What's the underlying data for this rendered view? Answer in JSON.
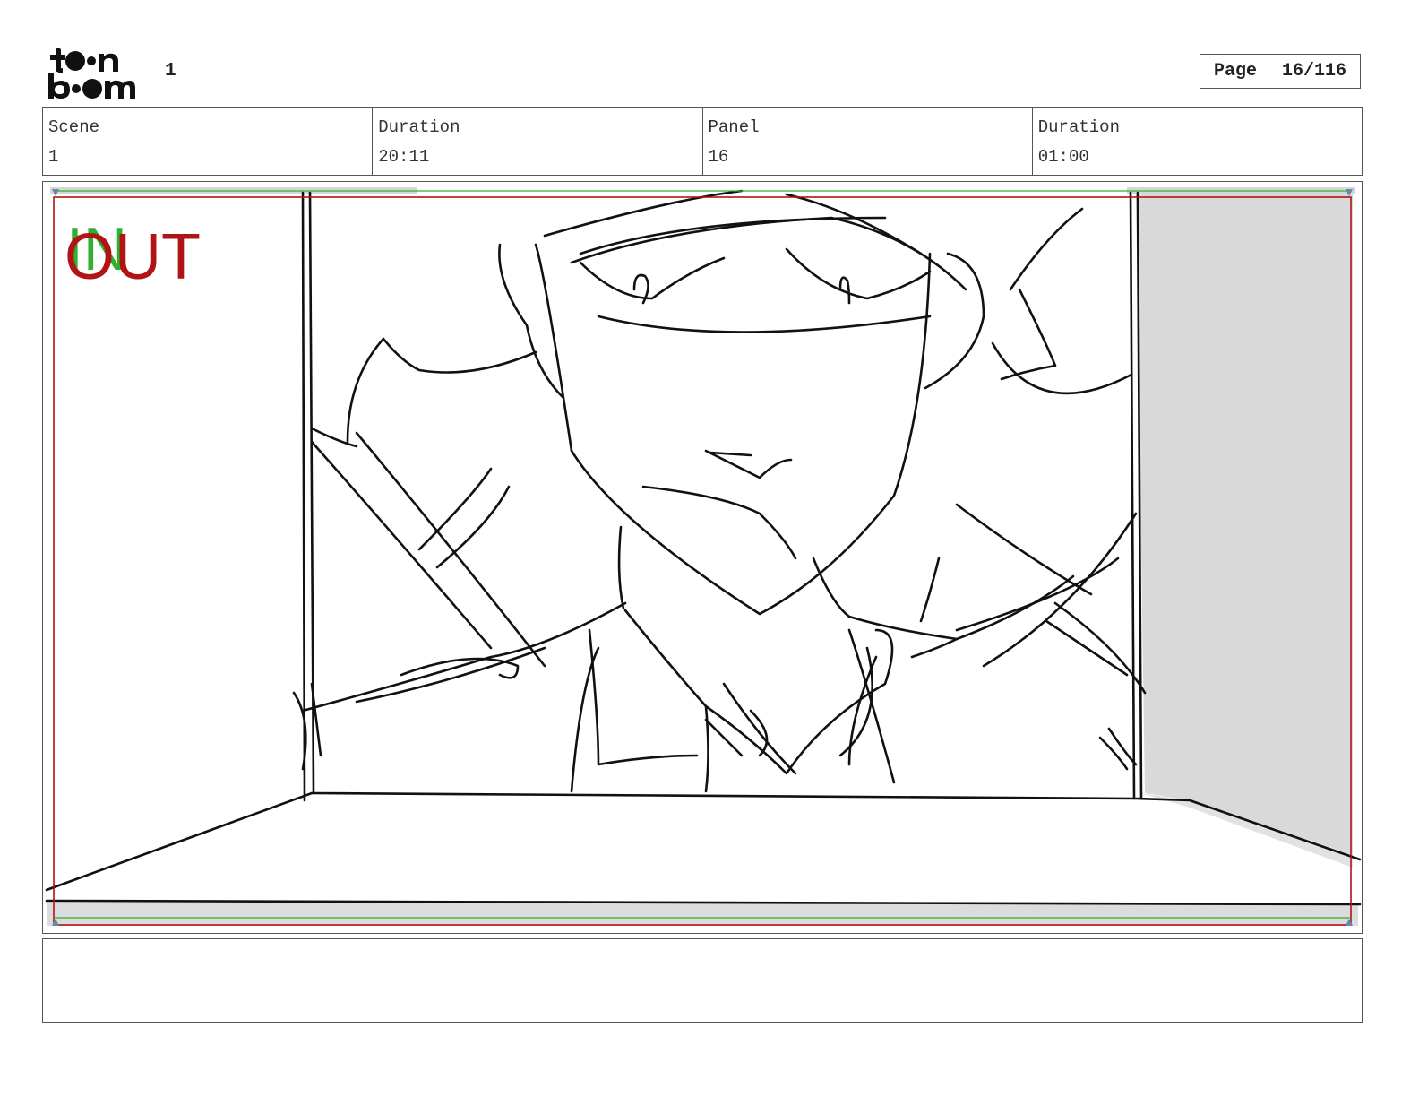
{
  "header": {
    "logo_text": "toon boom",
    "sheet_number": "1",
    "page_label": "Page",
    "page_value": "16/116"
  },
  "info": {
    "scene_label": "Scene",
    "scene_value": "1",
    "scene_duration_label": "Duration",
    "scene_duration_value": "20:11",
    "panel_label": "Panel",
    "panel_value": "16",
    "panel_duration_label": "Duration",
    "panel_duration_value": "01:00"
  },
  "panel": {
    "marker_in": "IN",
    "marker_out": "OUT",
    "in_color": "#2fb02f",
    "out_color": "#b01414",
    "safe_frame_color": "#b01414"
  },
  "notes": {
    "text": ""
  }
}
